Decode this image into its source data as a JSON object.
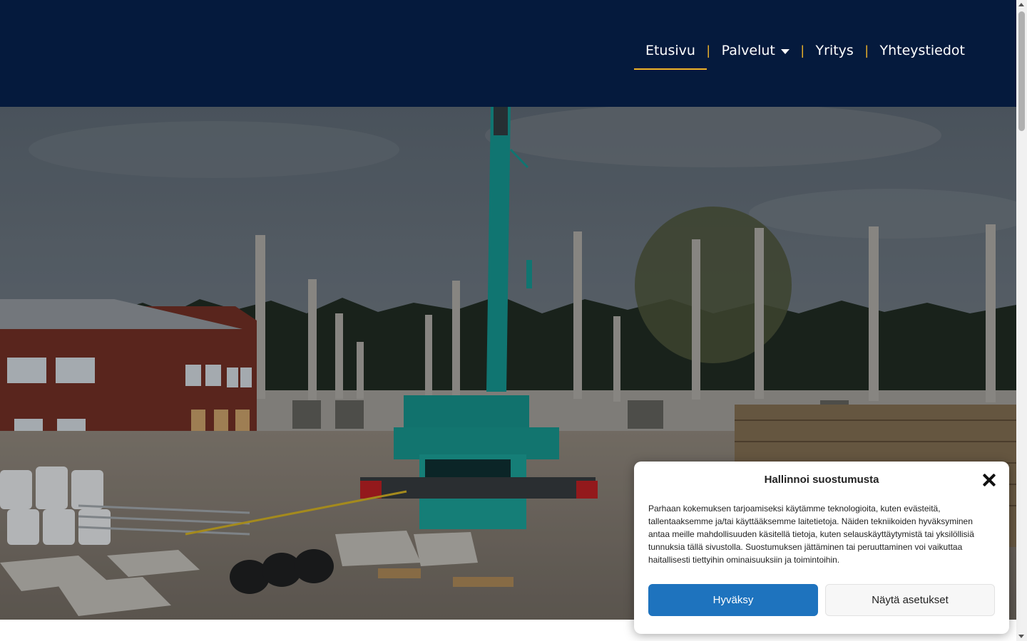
{
  "nav": {
    "items": [
      {
        "label": "Etusivu"
      },
      {
        "label": "Palvelut"
      },
      {
        "label": "Yritys"
      },
      {
        "label": "Yhteystiedot"
      }
    ],
    "separator": "|"
  },
  "consent": {
    "title": "Hallinnoi suostumusta",
    "text": "Parhaan kokemuksen tarjoamiseksi käytämme teknologioita, kuten evästeitä, tallentaaksemme ja/tai käyttääksemme laitetietoja. Näiden tekniikoiden hyväksyminen antaa meille mahdollisuuden käsitellä tietoja, kuten selauskäyttäytymistä tai yksilöllisiä tunnuksia tällä sivustolla. Suostumuksen jättäminen tai peruuttaminen voi vaikuttaa haitallisesti tiettyihin ominaisuuksiin ja toimintoihin.",
    "accept_label": "Hyväksy",
    "settings_label": "Näytä asetukset"
  },
  "colors": {
    "header_bg": "#051a3d",
    "accent": "#f0b429",
    "primary_button": "#1e73be"
  }
}
